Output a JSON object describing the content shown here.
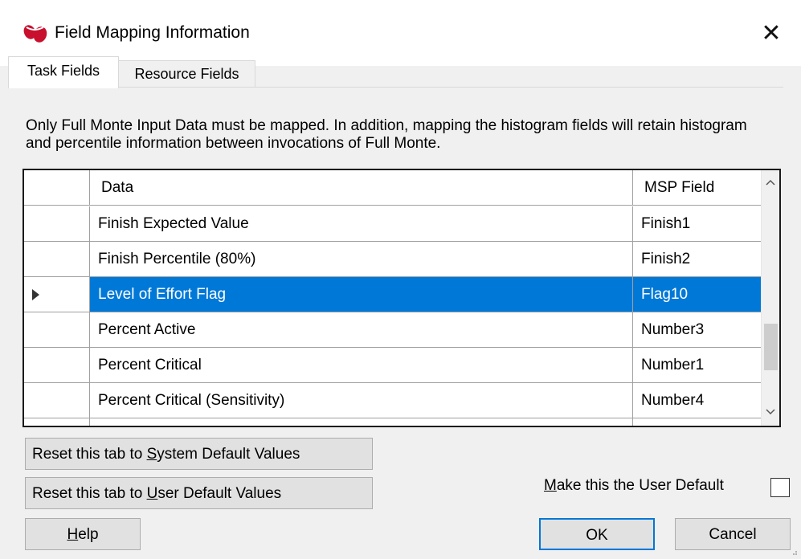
{
  "window": {
    "title": "Field Mapping Information",
    "icon": "app-logo-icon",
    "close_symbol": "✕"
  },
  "tabs": [
    {
      "label": "Task Fields",
      "active": true
    },
    {
      "label": "Resource Fields",
      "active": false
    }
  ],
  "info_text": "Only Full Monte Input Data must be mapped.  In addition, mapping the histogram fields will retain histogram and percentile information between invocations of Full Monte.",
  "grid": {
    "columns": {
      "data": "Data",
      "msp": "MSP Field"
    },
    "rows": [
      {
        "data": "Finish Expected Value",
        "msp": "Finish1",
        "selected": false
      },
      {
        "data": "Finish Percentile (80%)",
        "msp": "Finish2",
        "selected": false
      },
      {
        "data": "Level of Effort Flag",
        "msp": "Flag10",
        "selected": true
      },
      {
        "data": "Percent Active",
        "msp": "Number3",
        "selected": false
      },
      {
        "data": "Percent Critical",
        "msp": "Number1",
        "selected": false
      },
      {
        "data": "Percent Critical (Sensitivity)",
        "msp": "Number4",
        "selected": false
      }
    ],
    "scroll_up": "^",
    "scroll_down": "v"
  },
  "buttons": {
    "reset_system": {
      "pre": "Reset this tab to ",
      "key": "S",
      "post": "ystem Default Values"
    },
    "reset_user": {
      "pre": "Reset this tab to ",
      "key": "U",
      "post": "ser Default Values"
    },
    "help": {
      "key": "H",
      "post": "elp"
    },
    "ok": "OK",
    "cancel": "Cancel"
  },
  "user_default": {
    "key": "M",
    "post": "ake this the User Default",
    "checked": false
  },
  "colors": {
    "selection": "#0078d7",
    "accent_red": "#c8102e"
  }
}
